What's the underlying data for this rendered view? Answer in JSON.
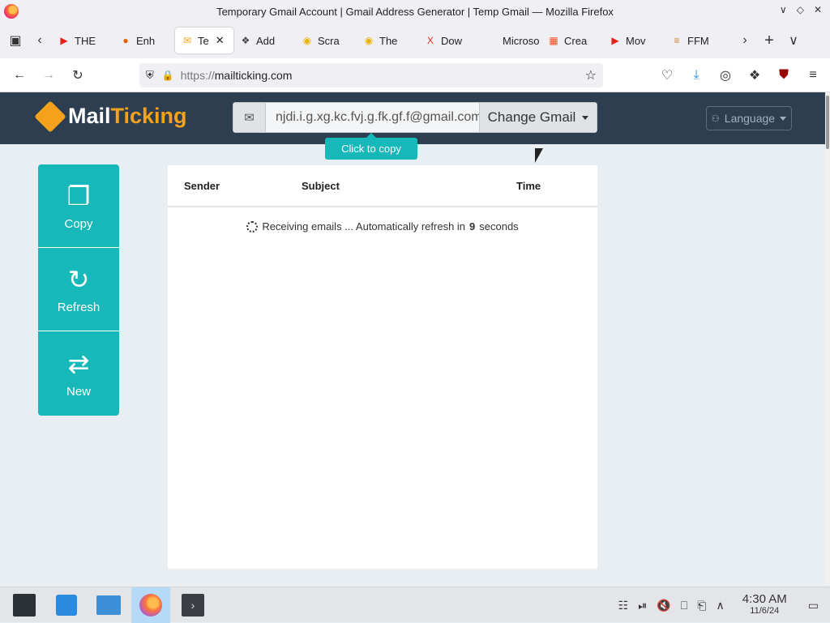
{
  "window": {
    "title": "Temporary Gmail Account | Gmail Address Generator | Temp Gmail — Mozilla Firefox"
  },
  "tabs": [
    {
      "label": "THE",
      "icon": "youtube-icon",
      "color": "#e62117"
    },
    {
      "label": "Enh",
      "icon": "firefox-icon",
      "color": "#e66000"
    },
    {
      "label": "Te",
      "icon": "mail-icon",
      "color": "#f4a21b",
      "active": true
    },
    {
      "label": "Add",
      "icon": "puzzle-icon",
      "color": "#444"
    },
    {
      "label": "Scra",
      "icon": "coin-icon",
      "color": "#e8b400"
    },
    {
      "label": "The",
      "icon": "coin-icon",
      "color": "#e8b400"
    },
    {
      "label": "Dow",
      "icon": "x-icon",
      "color": "#d93025"
    },
    {
      "label": "Microso",
      "icon": "none",
      "color": "#fff"
    },
    {
      "label": "Crea",
      "icon": "microsoft-icon",
      "color": "#f25022"
    },
    {
      "label": "Mov",
      "icon": "youtube-icon",
      "color": "#e62117"
    },
    {
      "label": "FFM",
      "icon": "ffmpeg-icon",
      "color": "#c77b2a"
    }
  ],
  "nav": {
    "url_proto": "https://",
    "url_host": "mailticking.com"
  },
  "site": {
    "logo_mail": "Mail",
    "logo_ticking": "Ticking",
    "email": "njdi.i.g.xg.kc.fvj.g.fk.gf.f@gmail.com",
    "change_label": "Change Gmail",
    "copy_tip": "Click to copy",
    "language_label": "Language"
  },
  "sidebar": [
    {
      "label": "Copy",
      "icon": "copy-icon"
    },
    {
      "label": "Refresh",
      "icon": "refresh-icon"
    },
    {
      "label": "New",
      "icon": "shuffle-icon"
    }
  ],
  "mailbox": {
    "col_sender": "Sender",
    "col_subject": "Subject",
    "col_time": "Time",
    "status_prefix": "Receiving emails ... Automatically refresh in",
    "status_seconds": "9",
    "status_suffix": "seconds"
  },
  "taskbar": {
    "time": "4:30 AM",
    "date": "11/6/24"
  },
  "colors": {
    "accent": "#16b8ba",
    "header": "#2c3e50",
    "brand": "#f4a21b"
  }
}
